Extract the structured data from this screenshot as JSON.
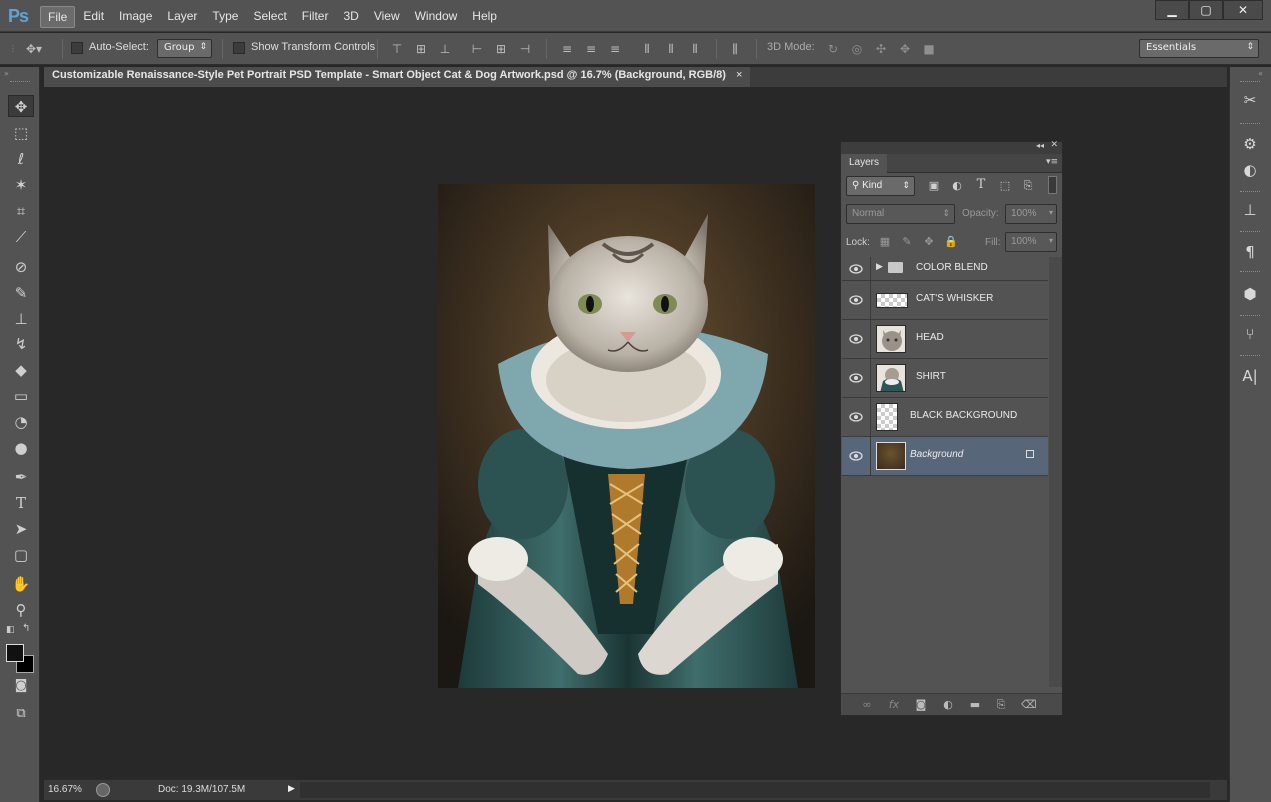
{
  "app": {
    "logo": "Ps",
    "menu": [
      "File",
      "Edit",
      "Image",
      "Layer",
      "Type",
      "Select",
      "Filter",
      "3D",
      "View",
      "Window",
      "Help"
    ],
    "active_menu": "File",
    "window_controls": {
      "minimize": "▁",
      "maximize": "▢",
      "close": "✕"
    }
  },
  "options_bar": {
    "auto_select_label": "Auto-Select:",
    "auto_select_value": "Group",
    "show_transform_label": "Show Transform Controls",
    "mode_3d_label": "3D Mode:",
    "workspace": "Essentials"
  },
  "document": {
    "tab_title": "Customizable Renaissance-Style Pet Portrait PSD Template - Smart Object Cat & Dog Artwork.psd @ 16.7% (Background, RGB/8)",
    "close_glyph": "×"
  },
  "status": {
    "zoom": "16.67%",
    "doc_size": "Doc: 19.3M/107.5M"
  },
  "layers_panel": {
    "tab": "Layers",
    "filter_kind": "Kind",
    "blend_mode": "Normal",
    "opacity_label": "Opacity:",
    "opacity_value": "100%",
    "lock_label": "Lock:",
    "fill_label": "Fill:",
    "fill_value": "100%",
    "layers": [
      {
        "name": "COLOR BLEND",
        "kind": "group"
      },
      {
        "name": "CAT'S WHISKER",
        "kind": "transparent"
      },
      {
        "name": "HEAD",
        "kind": "cat"
      },
      {
        "name": "SHIRT",
        "kind": "cat"
      },
      {
        "name": "BLACK BACKGROUND",
        "kind": "transparent-tall"
      },
      {
        "name": "Background",
        "kind": "background",
        "selected": true,
        "locked": true
      }
    ]
  },
  "colors": {
    "accent_selected_layer": "#58667a",
    "logo": "#5ea4d6",
    "panel": "#535353",
    "canvas": "#282828"
  },
  "icons": {
    "toolbar": [
      "move-tool-icon",
      "marquee-tool-icon",
      "lasso-tool-icon",
      "magic-wand-icon",
      "crop-tool-icon",
      "eyedropper-icon",
      "healing-brush-icon",
      "brush-tool-icon",
      "clone-stamp-icon",
      "history-brush-icon",
      "eraser-icon",
      "gradient-icon",
      "blur-tool-icon",
      "dodge-tool-icon",
      "pen-tool-icon",
      "type-tool-icon",
      "path-selection-icon",
      "shape-tool-icon",
      "hand-tool-icon",
      "zoom-tool-icon"
    ]
  }
}
